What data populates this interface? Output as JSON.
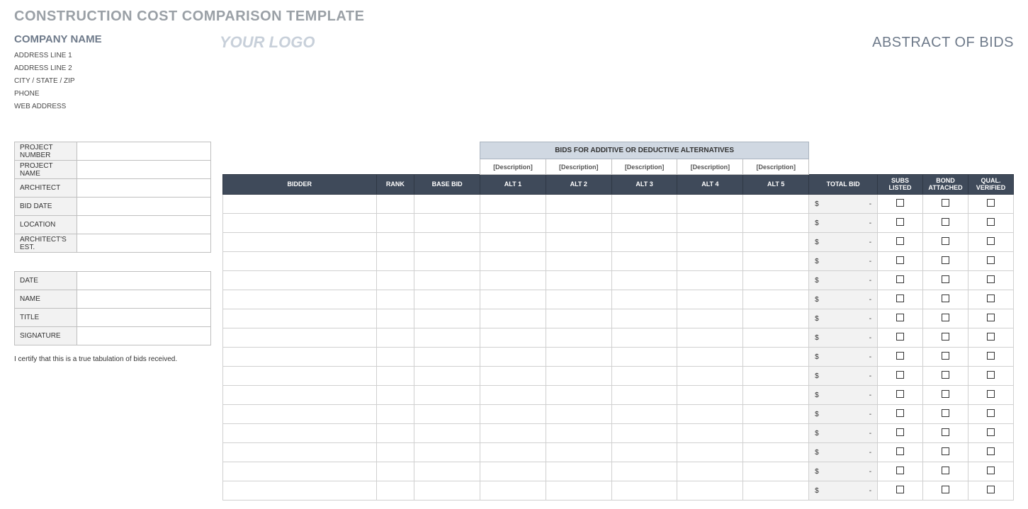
{
  "title": "CONSTRUCTION COST COMPARISON TEMPLATE",
  "company": {
    "name": "COMPANY NAME",
    "addr1": "ADDRESS LINE 1",
    "addr2": "ADDRESS LINE 2",
    "csz": "CITY / STATE / ZIP",
    "phone": "PHONE",
    "web": "WEB ADDRESS"
  },
  "logo_placeholder": "YOUR LOGO",
  "abstract_title": "ABSTRACT OF BIDS",
  "info_labels": {
    "project_number": "PROJECT NUMBER",
    "project_name": "PROJECT NAME",
    "architect": "ARCHITECT",
    "bid_date": "BID DATE",
    "location": "LOCATION",
    "architects_est": "ARCHITECT'S EST."
  },
  "info_values": {
    "project_number": "",
    "project_name": "",
    "architect": "",
    "bid_date": "",
    "location": "",
    "architects_est": ""
  },
  "sign_labels": {
    "date": "DATE",
    "name": "NAME",
    "title": "TITLE",
    "signature": "SIGNATURE"
  },
  "sign_values": {
    "date": "",
    "name": "",
    "title": "",
    "signature": ""
  },
  "certification": "I certify that this is a true tabulation of bids received.",
  "bids": {
    "alt_band": "BIDS FOR ADDITIVE OR DEDUCTIVE ALTERNATIVES",
    "desc_placeholder": "[Description]",
    "headers": {
      "bidder": "BIDDER",
      "rank": "RANK",
      "base_bid": "BASE BID",
      "alt1": "ALT 1",
      "alt2": "ALT 2",
      "alt3": "ALT 3",
      "alt4": "ALT 4",
      "alt5": "ALT 5",
      "total_bid": "TOTAL BID",
      "subs_listed": "SUBS LISTED",
      "bond_attached": "BOND ATTACHED",
      "qual_verified": "QUAL. VERIFIED"
    },
    "total_display": {
      "currency": "$",
      "dash": "-"
    },
    "row_count": 16
  }
}
